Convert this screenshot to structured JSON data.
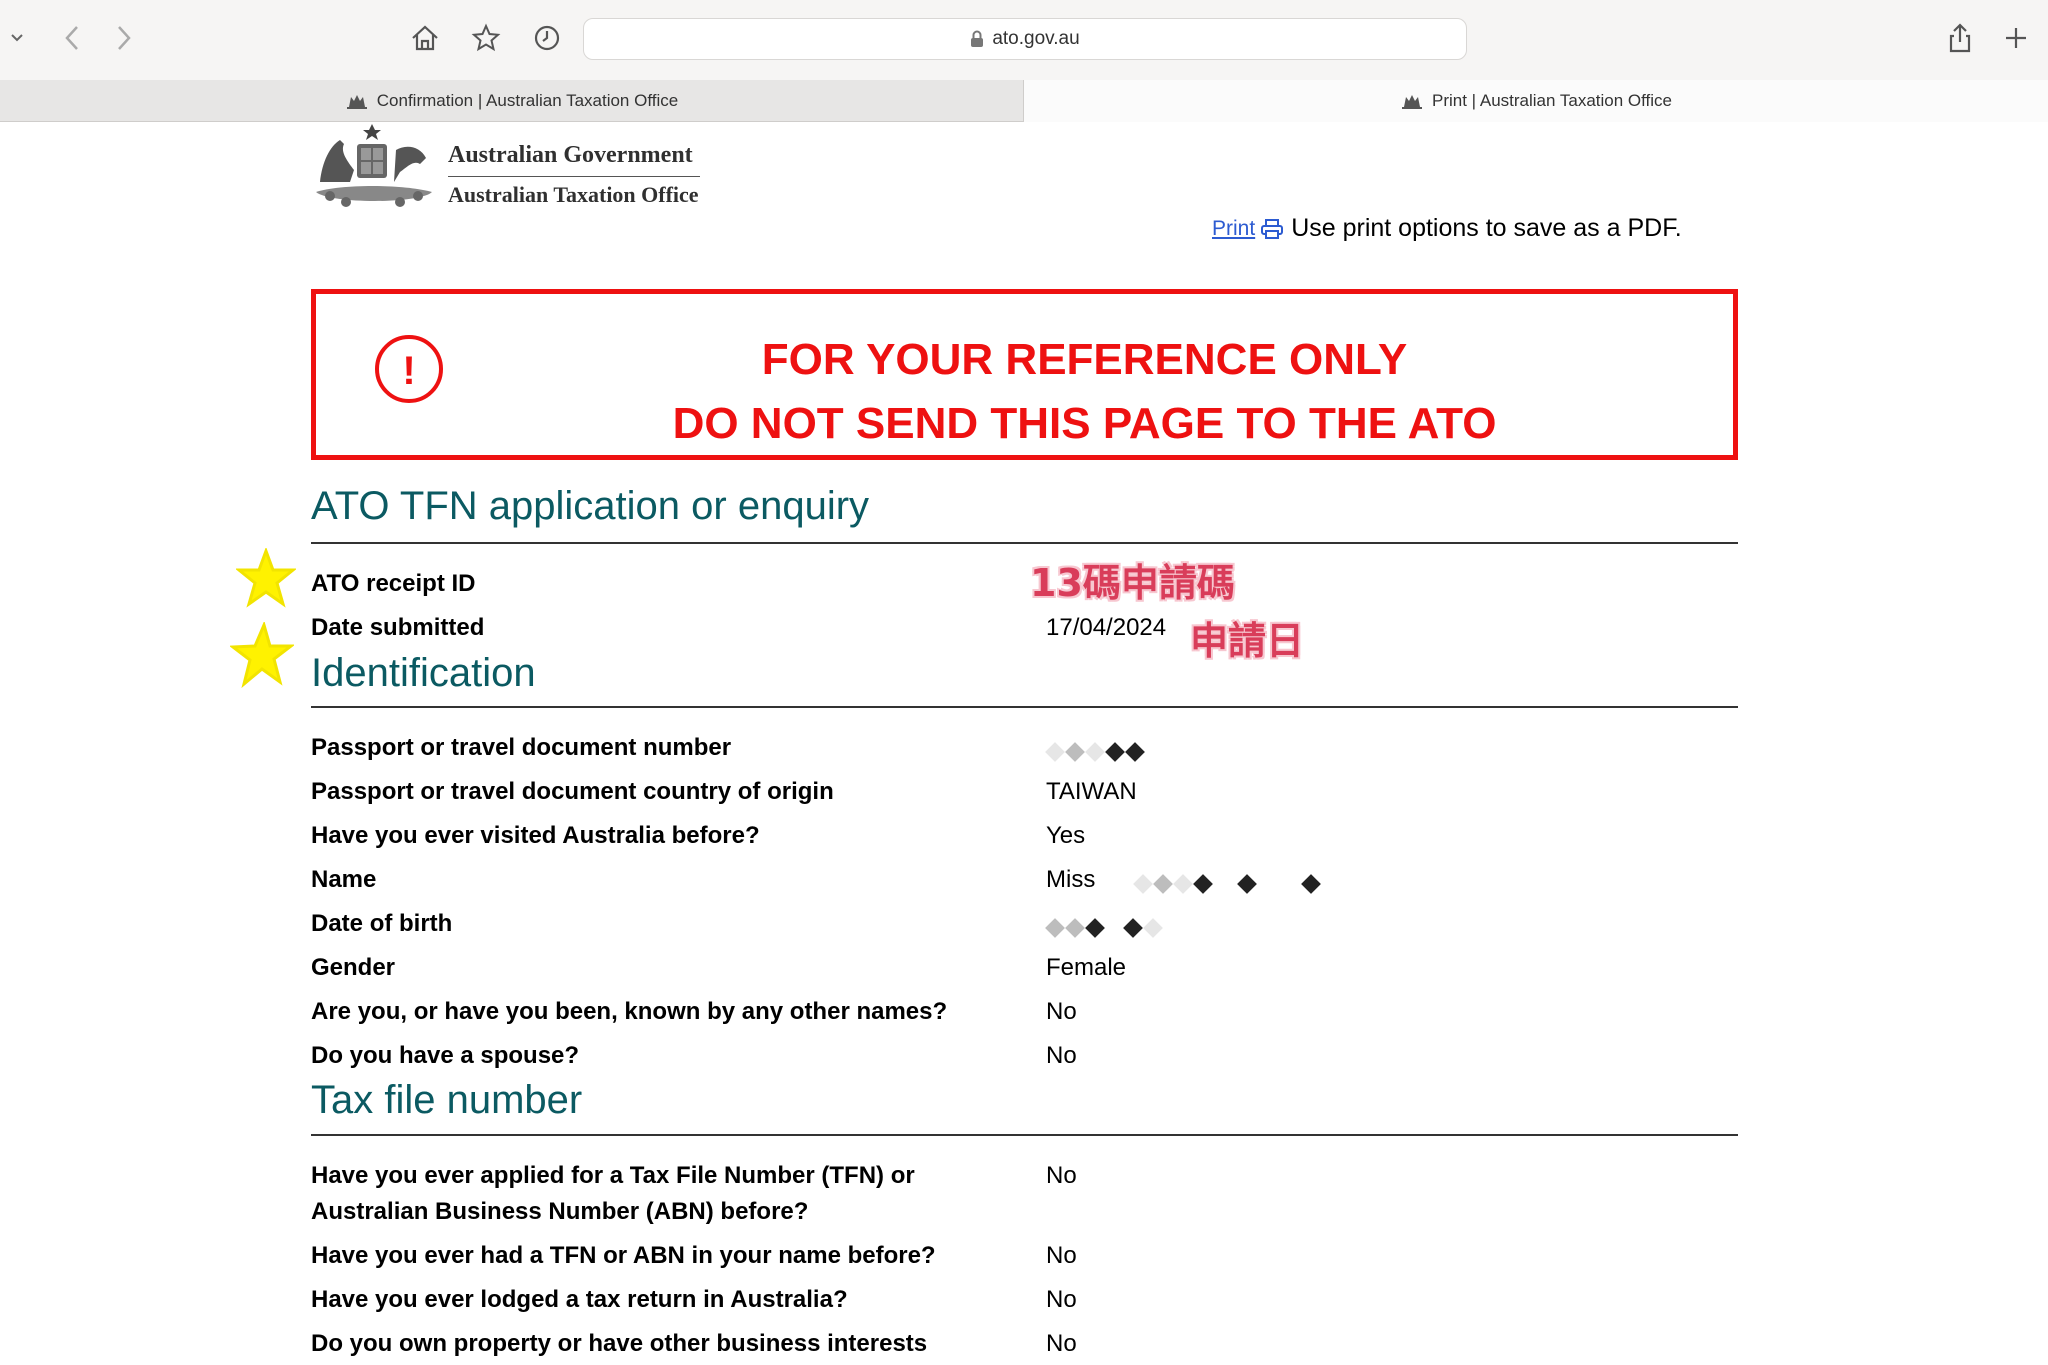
{
  "browser": {
    "url": "ato.gov.au",
    "tabs": [
      {
        "label": "Confirmation | Australian Taxation Office"
      },
      {
        "label": "Print | Australian Taxation Office"
      }
    ]
  },
  "header": {
    "gov_name": "Australian Government",
    "office_name": "Australian Taxation Office",
    "print_link": "Print",
    "print_hint": "Use print options to save as a PDF."
  },
  "warning": {
    "line1": "FOR YOUR REFERENCE ONLY",
    "line2": "DO NOT SEND THIS PAGE TO THE ATO",
    "icon": "!"
  },
  "sections": {
    "application": {
      "title": "ATO TFN application or enquiry",
      "receipt_label": "ATO receipt ID",
      "date_label": "Date submitted",
      "date_value": "17/04/2024"
    },
    "identification": {
      "title": "Identification",
      "passport_label": "Passport or travel document number",
      "country_label": "Passport or travel document country of origin",
      "country_value": "TAIWAN",
      "visited_label": "Have you ever visited Australia before?",
      "visited_value": "Yes",
      "name_label": "Name",
      "name_value": "Miss",
      "dob_label": "Date of birth",
      "gender_label": "Gender",
      "gender_value": "Female",
      "other_names_label": "Are you, or have you been, known by any other names?",
      "other_names_value": "No",
      "spouse_label": "Do you have a spouse?",
      "spouse_value": "No"
    },
    "tfn": {
      "title": "Tax file number",
      "applied_label_1": "Have you ever applied for a Tax File Number (TFN) or",
      "applied_label_2": "Australian Business Number (ABN) before?",
      "applied_value": "No",
      "had_label": "Have you ever had a TFN or ABN in your name before?",
      "had_value": "No",
      "lodged_label": "Have you ever lodged a tax return in Australia?",
      "lodged_value": "No",
      "property_label": "Do you own property or have other business interests",
      "property_value": "No"
    }
  },
  "annotations": {
    "receipt_note": "13碼申請碼",
    "date_note": "申請日"
  },
  "colors": {
    "warning_red": "#ee1111",
    "heading_teal": "#0b5a62",
    "link_blue": "#2c5bd1",
    "star_yellow": "#fff200"
  }
}
